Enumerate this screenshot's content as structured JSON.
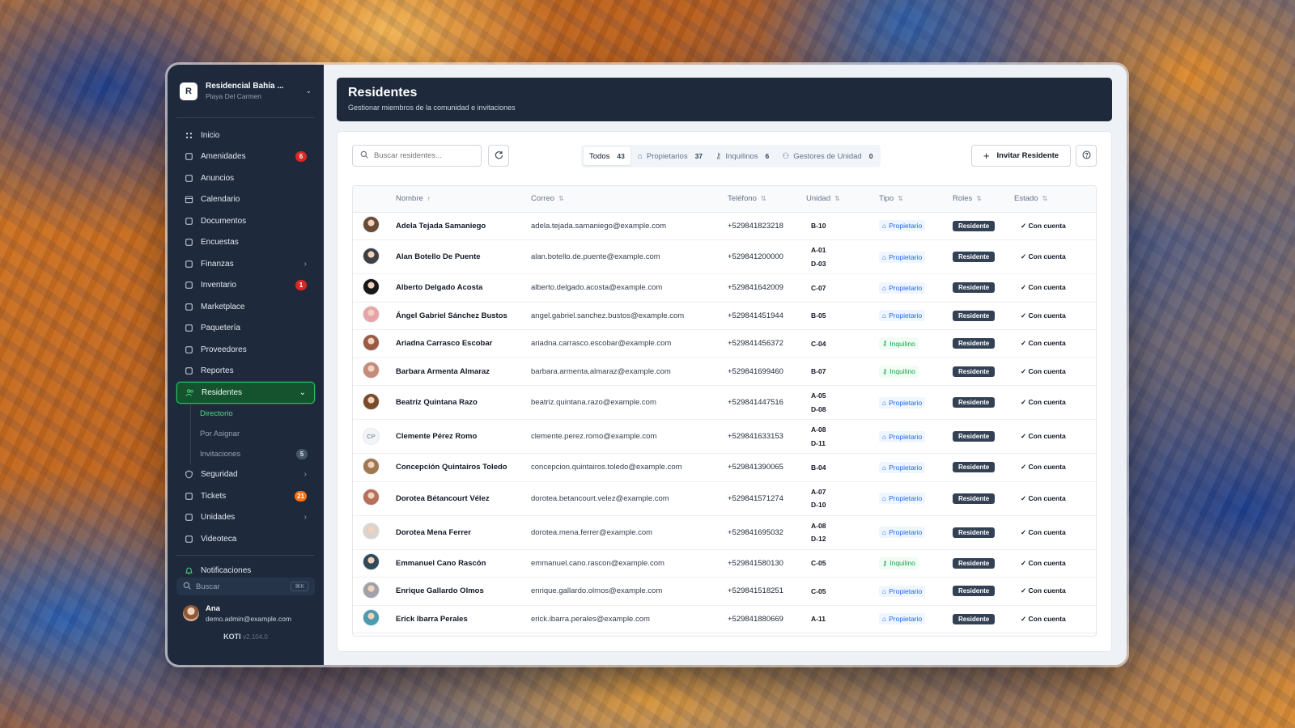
{
  "org": {
    "name": "Residencial Bahía ...",
    "location": "Playa Del Carmen",
    "logo": "R"
  },
  "sidebar": {
    "items": [
      {
        "label": "Inicio",
        "icon": "home-icon"
      },
      {
        "label": "Amenidades",
        "icon": "building-icon",
        "badge": "6"
      },
      {
        "label": "Anuncios",
        "icon": "megaphone-icon"
      },
      {
        "label": "Calendario",
        "icon": "calendar-icon"
      },
      {
        "label": "Documentos",
        "icon": "document-icon"
      },
      {
        "label": "Encuestas",
        "icon": "poll-icon"
      },
      {
        "label": "Finanzas",
        "icon": "wallet-icon",
        "arrow": "›"
      },
      {
        "label": "Inventario",
        "icon": "box-icon",
        "badge": "1"
      },
      {
        "label": "Marketplace",
        "icon": "store-icon"
      },
      {
        "label": "Paquetería",
        "icon": "package-icon"
      },
      {
        "label": "Proveedores",
        "icon": "truck-icon"
      },
      {
        "label": "Reportes",
        "icon": "report-icon"
      },
      {
        "label": "Residentes",
        "icon": "users-icon",
        "arrow": "⌄"
      },
      {
        "label": "Seguridad",
        "icon": "shield-icon",
        "arrow": "›"
      },
      {
        "label": "Tickets",
        "icon": "ticket-icon",
        "badge": "21"
      },
      {
        "label": "Unidades",
        "icon": "grid-icon",
        "arrow": "›"
      },
      {
        "label": "Videoteca",
        "icon": "video-icon"
      },
      {
        "label": "Notificaciones",
        "icon": "bell-icon"
      }
    ],
    "sub_items": [
      {
        "label": "Directorio"
      },
      {
        "label": "Por Asignar"
      },
      {
        "label": "Invitaciones",
        "badge": "5"
      }
    ],
    "search_placeholder": "Buscar",
    "search_shortcut": "⌘K",
    "user": {
      "name": "Ana",
      "email": "demo.admin@example.com"
    },
    "app_name": "KOTI",
    "version": "v2.104.0"
  },
  "header": {
    "title": "Residentes",
    "subtitle": "Gestionar miembros de la comunidad e invitaciones"
  },
  "toolbar": {
    "search_placeholder": "Buscar residentes...",
    "filters": [
      {
        "label": "Todos",
        "count": "43"
      },
      {
        "label": "Propietarios",
        "count": "37"
      },
      {
        "label": "Inquilinos",
        "count": "6"
      },
      {
        "label": "Gestores de Unidad",
        "count": "0"
      }
    ],
    "invite_label": "Invitar Residente"
  },
  "table": {
    "columns": [
      "Nombre",
      "Correo",
      "Teléfono",
      "Unidad",
      "Tipo",
      "Roles",
      "Estado"
    ],
    "rows": [
      {
        "initials": "",
        "name": "Adela Tejada Samaniego",
        "email": "adela.tejada.samaniego@example.com",
        "phone": "+529841823218",
        "units": [
          "B-10"
        ],
        "type": "Propietario",
        "role": "Residente",
        "status": "Con cuenta"
      },
      {
        "initials": "",
        "name": "Alan Botello De Puente",
        "email": "alan.botello.de.puente@example.com",
        "phone": "+529841200000",
        "units": [
          "A-01",
          "D-03"
        ],
        "type": "Propietario",
        "role": "Residente",
        "status": "Con cuenta"
      },
      {
        "initials": "",
        "name": "Alberto Delgado Acosta",
        "email": "alberto.delgado.acosta@example.com",
        "phone": "+529841642009",
        "units": [
          "C-07"
        ],
        "type": "Propietario",
        "role": "Residente",
        "status": "Con cuenta"
      },
      {
        "initials": "",
        "name": "Ángel Gabriel Sánchez Bustos",
        "email": "angel.gabriel.sanchez.bustos@example.com",
        "phone": "+529841451944",
        "units": [
          "B-05"
        ],
        "type": "Propietario",
        "role": "Residente",
        "status": "Con cuenta"
      },
      {
        "initials": "",
        "name": "Ariadna Carrasco Escobar",
        "email": "ariadna.carrasco.escobar@example.com",
        "phone": "+529841456372",
        "units": [
          "C-04"
        ],
        "type": "Inquilino",
        "role": "Residente",
        "status": "Con cuenta"
      },
      {
        "initials": "",
        "name": "Barbara Armenta Almaraz",
        "email": "barbara.armenta.almaraz@example.com",
        "phone": "+529841699460",
        "units": [
          "B-07"
        ],
        "type": "Inquilino",
        "role": "Residente",
        "status": "Con cuenta"
      },
      {
        "initials": "",
        "name": "Beatriz Quintana Razo",
        "email": "beatriz.quintana.razo@example.com",
        "phone": "+529841447516",
        "units": [
          "A-05",
          "D-08"
        ],
        "type": "Propietario",
        "role": "Residente",
        "status": "Con cuenta"
      },
      {
        "initials": "CP",
        "name": "Clemente Pérez Romo",
        "email": "clemente.perez.romo@example.com",
        "phone": "+529841633153",
        "units": [
          "A-08",
          "D-11"
        ],
        "type": "Propietario",
        "role": "Residente",
        "status": "Con cuenta"
      },
      {
        "initials": "",
        "name": "Concepción Quintairos Toledo",
        "email": "concepcion.quintairos.toledo@example.com",
        "phone": "+529841390065",
        "units": [
          "B-04"
        ],
        "type": "Propietario",
        "role": "Residente",
        "status": "Con cuenta"
      },
      {
        "initials": "",
        "name": "Dorotea Bétancourt Vélez",
        "email": "dorotea.betancourt.velez@example.com",
        "phone": "+529841571274",
        "units": [
          "A-07",
          "D-10"
        ],
        "type": "Propietario",
        "role": "Residente",
        "status": "Con cuenta"
      },
      {
        "initials": "",
        "name": "Dorotea Mena Ferrer",
        "email": "dorotea.mena.ferrer@example.com",
        "phone": "+529841695032",
        "units": [
          "A-08",
          "D-12"
        ],
        "type": "Propietario",
        "role": "Residente",
        "status": "Con cuenta"
      },
      {
        "initials": "",
        "name": "Emmanuel Cano Rascón",
        "email": "emmanuel.cano.rascon@example.com",
        "phone": "+529841580130",
        "units": [
          "C-05"
        ],
        "type": "Inquilino",
        "role": "Residente",
        "status": "Con cuenta"
      },
      {
        "initials": "",
        "name": "Enrique Gallardo Olmos",
        "email": "enrique.gallardo.olmos@example.com",
        "phone": "+529841518251",
        "units": [
          "C-05"
        ],
        "type": "Propietario",
        "role": "Residente",
        "status": "Con cuenta"
      },
      {
        "initials": "",
        "name": "Erick Ibarra Perales",
        "email": "erick.ibarra.perales@example.com",
        "phone": "+529841880669",
        "units": [
          "A-11"
        ],
        "type": "Propietario",
        "role": "Residente",
        "status": "Con cuenta"
      }
    ]
  }
}
